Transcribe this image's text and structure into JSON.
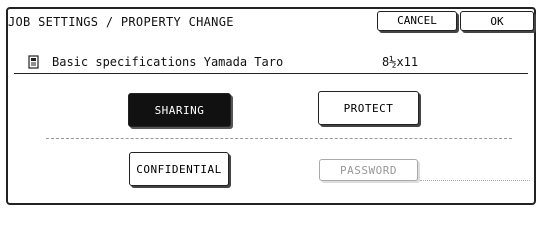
{
  "header": {
    "title": "JOB SETTINGS / PROPERTY CHANGE",
    "cancel_label": "CANCEL",
    "ok_label": "OK"
  },
  "job": {
    "icon": "document-icon",
    "name": "Basic specifications Yamada Taro",
    "size": "8½x11"
  },
  "buttons": {
    "sharing": "SHARING",
    "protect": "PROTECT",
    "confidential": "CONFIDENTIAL",
    "password": "PASSWORD"
  },
  "colors": {
    "selected_bg": "#111111",
    "selected_text": "#ffffff",
    "disabled_text": "#999999"
  }
}
